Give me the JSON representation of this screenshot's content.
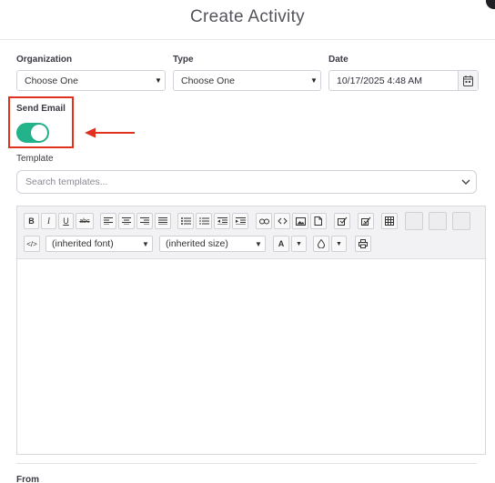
{
  "header": {
    "title": "Create Activity"
  },
  "form": {
    "organization": {
      "label": "Organization",
      "value": "Choose One"
    },
    "type": {
      "label": "Type",
      "value": "Choose One"
    },
    "date": {
      "label": "Date",
      "value": "10/17/2025 4:48 AM"
    },
    "send_email": {
      "label": "Send Email",
      "enabled": true
    },
    "template": {
      "label": "Template",
      "placeholder": "Search templates..."
    },
    "from": {
      "label": "From"
    }
  },
  "editor": {
    "toolbar_row1": [
      "bold",
      "italic",
      "underline",
      "strikethrough",
      "align-left",
      "align-center",
      "align-right",
      "justify",
      "bullet-list",
      "numbered-list",
      "outdent",
      "indent",
      "link",
      "unlink",
      "image",
      "document",
      "checklist",
      "checklist-alt",
      "table"
    ],
    "toolbar_row2": {
      "font": "(inherited font)",
      "size": "(inherited size)",
      "text_color_letter": "A",
      "strike_label": "abc"
    }
  },
  "colors": {
    "toggle_on": "#22b38a",
    "highlight": "#e0301e",
    "arrow": "#e0301e"
  }
}
